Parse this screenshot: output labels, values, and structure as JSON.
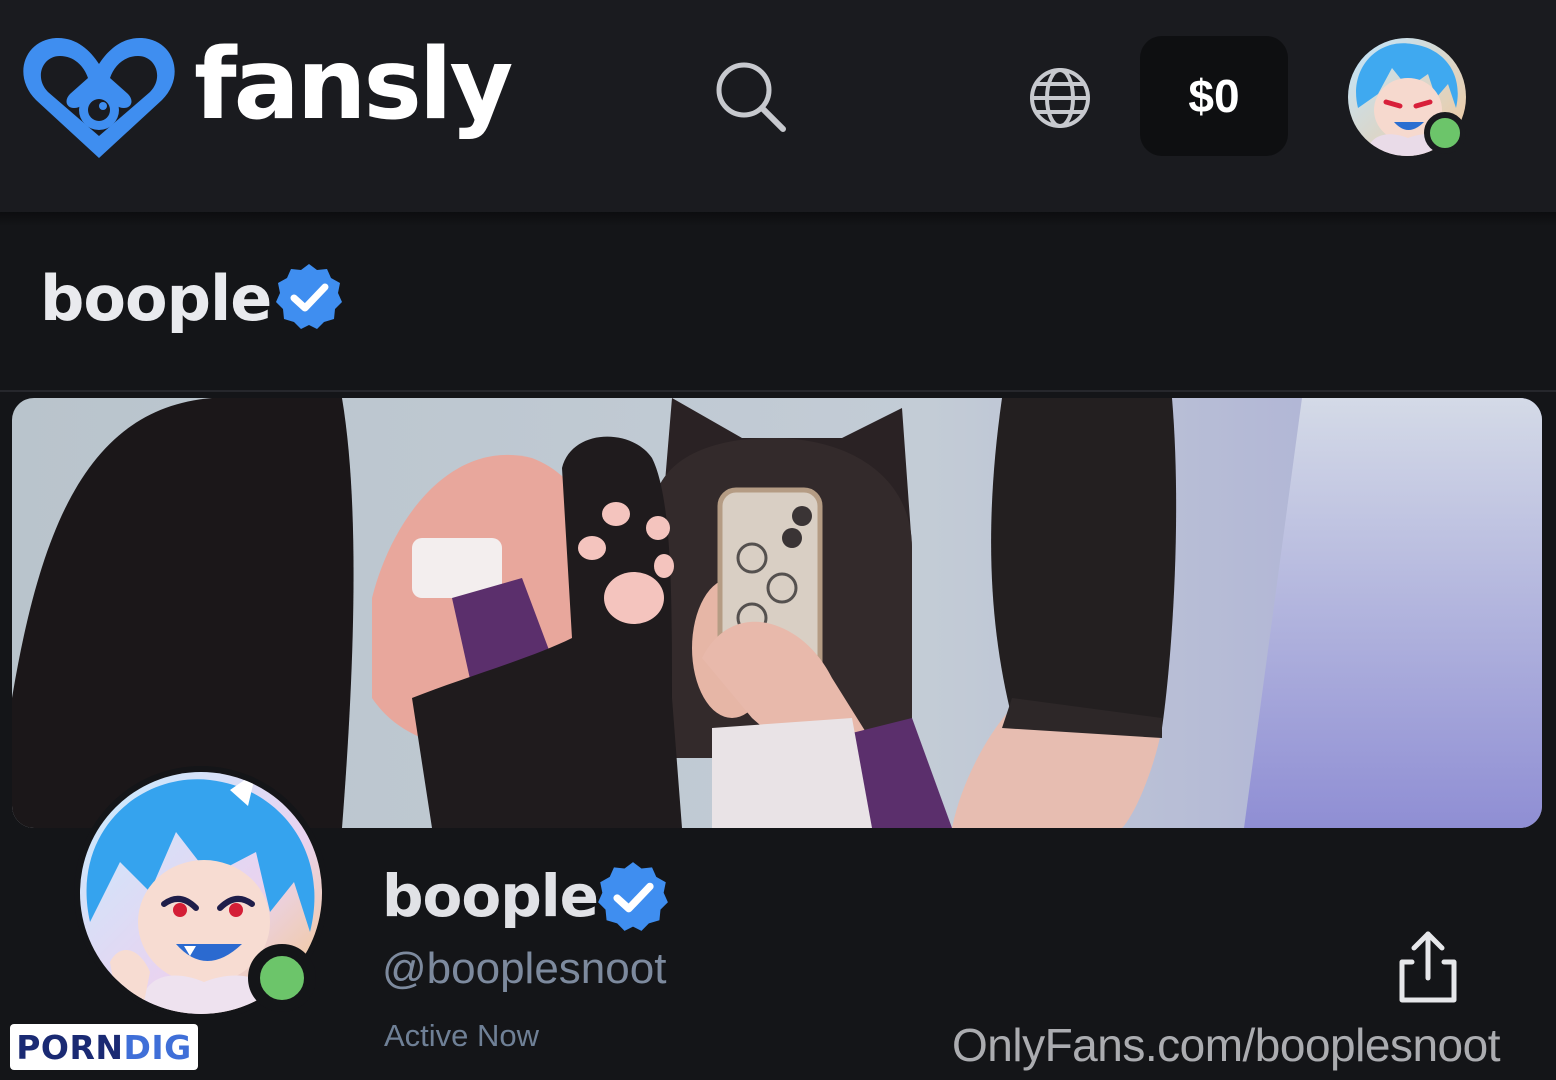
{
  "header": {
    "logo_text": "fansly",
    "wallet_balance": "$0",
    "user_online": true
  },
  "title_bar": {
    "name": "boople",
    "verified": true
  },
  "profile": {
    "display_name": "boople",
    "verified": true,
    "handle": "@booplesnoot",
    "status": "Active Now",
    "online": true
  },
  "watermarks": {
    "site_text": "OnlyFans.com/booplesnoot",
    "badge_part1": "PORN",
    "badge_part2": "DIG"
  },
  "colors": {
    "brand_blue": "#3f8ef0",
    "online_green": "#6cc56a",
    "background": "#141518",
    "header_bg": "#1a1b1f"
  },
  "icons": {
    "search": "search-icon",
    "language": "globe-icon",
    "verified": "verified-badge-icon",
    "share": "share-icon"
  }
}
